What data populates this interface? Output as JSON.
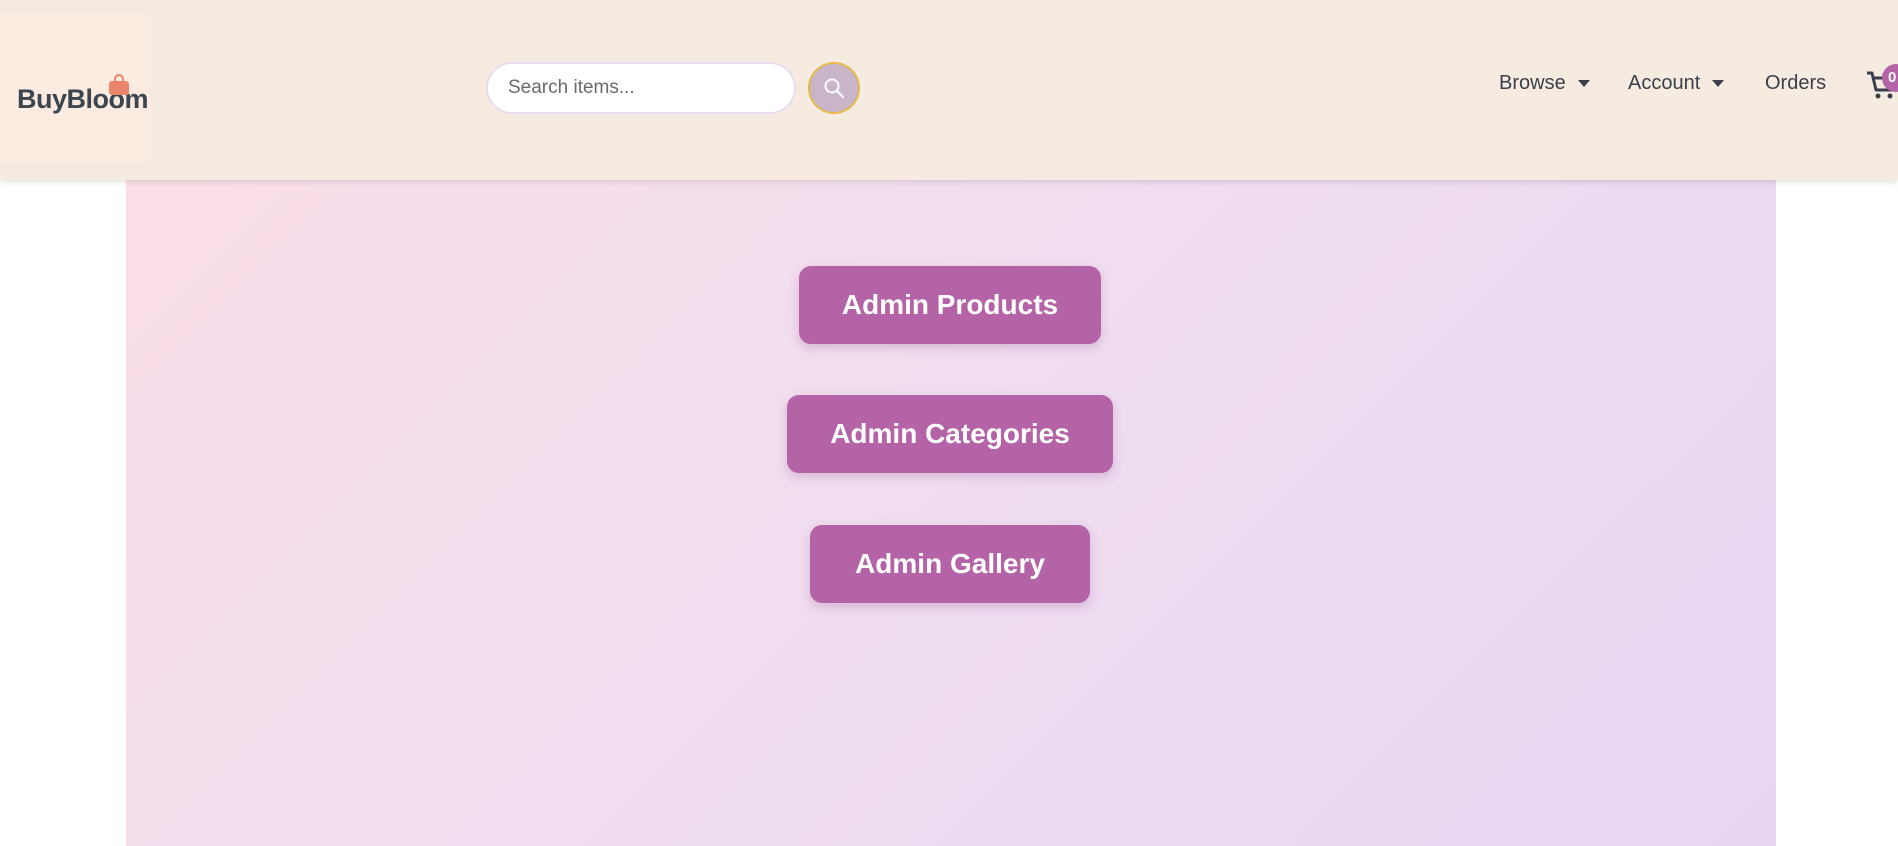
{
  "brand": {
    "name": "BuyBloom"
  },
  "search": {
    "placeholder": "Search items..."
  },
  "nav": {
    "browse": "Browse",
    "account": "Account",
    "orders": "Orders",
    "cart_count": "0"
  },
  "admin": {
    "products": "Admin Products",
    "categories": "Admin Categories",
    "gallery": "Admin Gallery"
  },
  "colors": {
    "navbar_bg": "#f5ebe1",
    "accent": "#b463a6",
    "search_button": "#c8b6c8",
    "search_button_border": "#e6b84a",
    "logo_bag": "#e8856a"
  },
  "icons": {
    "logo": "shopping-bag-icon",
    "search": "search-icon",
    "cart": "cart-icon",
    "dropdown": "caret-down-icon"
  }
}
